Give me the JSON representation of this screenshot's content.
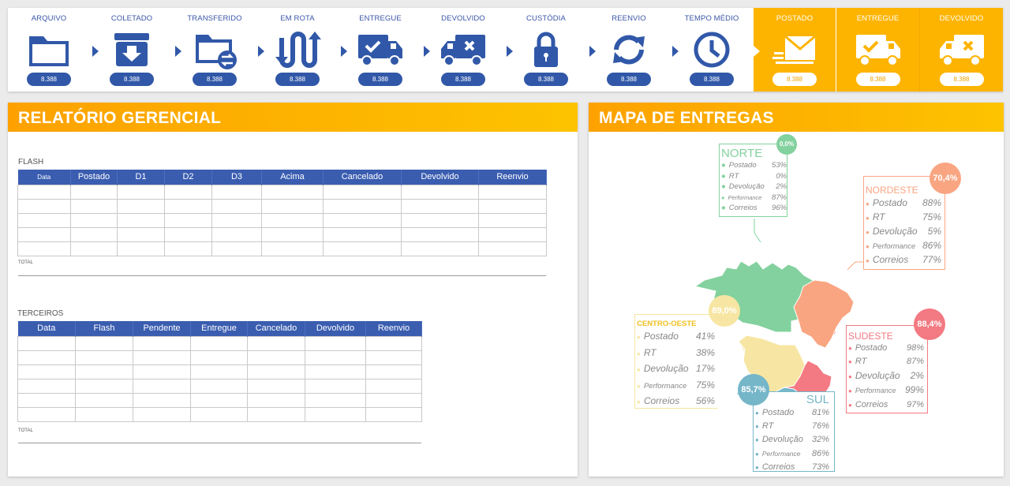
{
  "pipeline": {
    "steps": [
      {
        "label": "ARQUIVO",
        "icon": "folder-icon",
        "value": "8.388"
      },
      {
        "label": "COLETADO",
        "icon": "archive-box-icon",
        "value": "8.388"
      },
      {
        "label": "TRANSFERIDO",
        "icon": "folder-transfer-icon",
        "value": "8.388"
      },
      {
        "label": "EM ROTA",
        "icon": "route-icon",
        "value": "8.388"
      },
      {
        "label": "ENTREGUE",
        "icon": "truck-check-icon",
        "value": "8.388"
      },
      {
        "label": "DEVOLVIDO",
        "icon": "truck-x-icon",
        "value": "8.388"
      },
      {
        "label": "CUSTÓDIA",
        "icon": "lock-icon",
        "value": "8.388"
      },
      {
        "label": "REENVIO",
        "icon": "refresh-icon",
        "value": "8.388"
      },
      {
        "label": "TEMPO MÉDIO",
        "icon": "clock-icon",
        "value": "8.388"
      },
      {
        "label": "POSTADO",
        "icon": "mail-icon",
        "value": "8.388"
      },
      {
        "label": "ENTREGUE",
        "icon": "truck-check-icon",
        "value": "8.388"
      },
      {
        "label": "DEVOLVIDO",
        "icon": "truck-x-icon",
        "value": "8.388"
      }
    ],
    "highlight_color": "#fdb400",
    "accent_color": "#3158a8"
  },
  "report": {
    "title": "RELATÓRIO GERENCIAL",
    "flash": {
      "title": "FLASH",
      "columns": [
        "Data",
        "Postado",
        "D1",
        "D2",
        "D3",
        "Acima",
        "Cancelado",
        "Devolvido",
        "Reenvio"
      ],
      "total_label": "TOTAL"
    },
    "terceiros": {
      "title": "TERCEIROS",
      "columns": [
        "Data",
        "Flash",
        "Pendente",
        "Entregue",
        "Cancelado",
        "Devolvido",
        "Reenvio"
      ],
      "total_label": "TOTAL"
    }
  },
  "map": {
    "title": "MAPA DE ENTREGAS",
    "regions": {
      "norte": {
        "name": "NORTE",
        "percent": "0,0%",
        "color": "#83d19e",
        "metrics": [
          {
            "label": "Postado",
            "value": "53%"
          },
          {
            "label": "RT",
            "value": "0%"
          },
          {
            "label": "Devolução",
            "value": "2%"
          },
          {
            "label": "Performance",
            "value": "87%"
          },
          {
            "label": "Correios",
            "value": "96%"
          }
        ]
      },
      "nordeste": {
        "name": "NORDESTE",
        "percent": "70,4%",
        "color": "#f9a582",
        "metrics": [
          {
            "label": "Postado",
            "value": "88%"
          },
          {
            "label": "RT",
            "value": "75%"
          },
          {
            "label": "Devolução",
            "value": "5%"
          },
          {
            "label": "Performance",
            "value": "86%"
          },
          {
            "label": "Correios",
            "value": "77%"
          }
        ]
      },
      "centro_oeste": {
        "name": "CENTRO-OESTE",
        "percent": "89,0%",
        "color": "#f7e6a3",
        "name_color": "#f0c020",
        "metrics": [
          {
            "label": "Postado",
            "value": "41%"
          },
          {
            "label": "RT",
            "value": "38%"
          },
          {
            "label": "Devolução",
            "value": "17%"
          },
          {
            "label": "Performance",
            "value": "75%"
          },
          {
            "label": "Correios",
            "value": "56%"
          }
        ]
      },
      "sudeste": {
        "name": "SUDESTE",
        "percent": "88,4%",
        "color": "#f37a82",
        "metrics": [
          {
            "label": "Postado",
            "value": "98%"
          },
          {
            "label": "RT",
            "value": "87%"
          },
          {
            "label": "Devolução",
            "value": "2%"
          },
          {
            "label": "Performance",
            "value": "99%"
          },
          {
            "label": "Correios",
            "value": "97%"
          }
        ]
      },
      "sul": {
        "name": "SUL",
        "percent": "85,7%",
        "color": "#75b6c9",
        "metrics": [
          {
            "label": "Postado",
            "value": "81%"
          },
          {
            "label": "RT",
            "value": "76%"
          },
          {
            "label": "Devolução",
            "value": "32%"
          },
          {
            "label": "Performance",
            "value": "86%"
          },
          {
            "label": "Correios",
            "value": "73%"
          }
        ]
      }
    }
  }
}
